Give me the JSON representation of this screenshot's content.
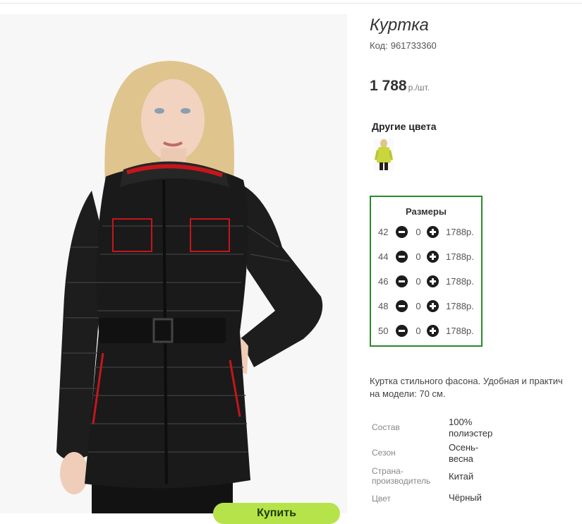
{
  "product": {
    "title": "Куртка",
    "code_label": "Код:",
    "code": "961733360",
    "price": "1 788",
    "price_unit": "р./шт."
  },
  "other_colors": {
    "title": "Другие цвета",
    "swatches": [
      {
        "color": "#c9d63e",
        "icon": "yellow-jacket-thumbnail"
      }
    ]
  },
  "sizes": {
    "title": "Размеры",
    "rows": [
      {
        "size": "42",
        "qty": "0",
        "price": "1788р."
      },
      {
        "size": "44",
        "qty": "0",
        "price": "1788р."
      },
      {
        "size": "46",
        "qty": "0",
        "price": "1788р."
      },
      {
        "size": "48",
        "qty": "0",
        "price": "1788р."
      },
      {
        "size": "50",
        "qty": "0",
        "price": "1788р."
      }
    ]
  },
  "description": {
    "line1": "Куртка стильного фасона. Удобная и практич",
    "line2": "на модели: 70 см."
  },
  "specs": [
    {
      "key": "Состав",
      "value": [
        "100%",
        "полиэстер"
      ]
    },
    {
      "key": "Сезон",
      "value": [
        "Осень-",
        "весна"
      ]
    },
    {
      "key": [
        "Страна-",
        "производитель"
      ],
      "value": "Китай"
    },
    {
      "key": "Цвет",
      "value": "Чёрный"
    }
  ],
  "buy_button": {
    "label": "Купить"
  },
  "colors": {
    "accent_green": "#2b8a2b",
    "jacket": "#1a1a1a",
    "piping_red": "#c4161c",
    "button_green": "#b7e34a"
  }
}
